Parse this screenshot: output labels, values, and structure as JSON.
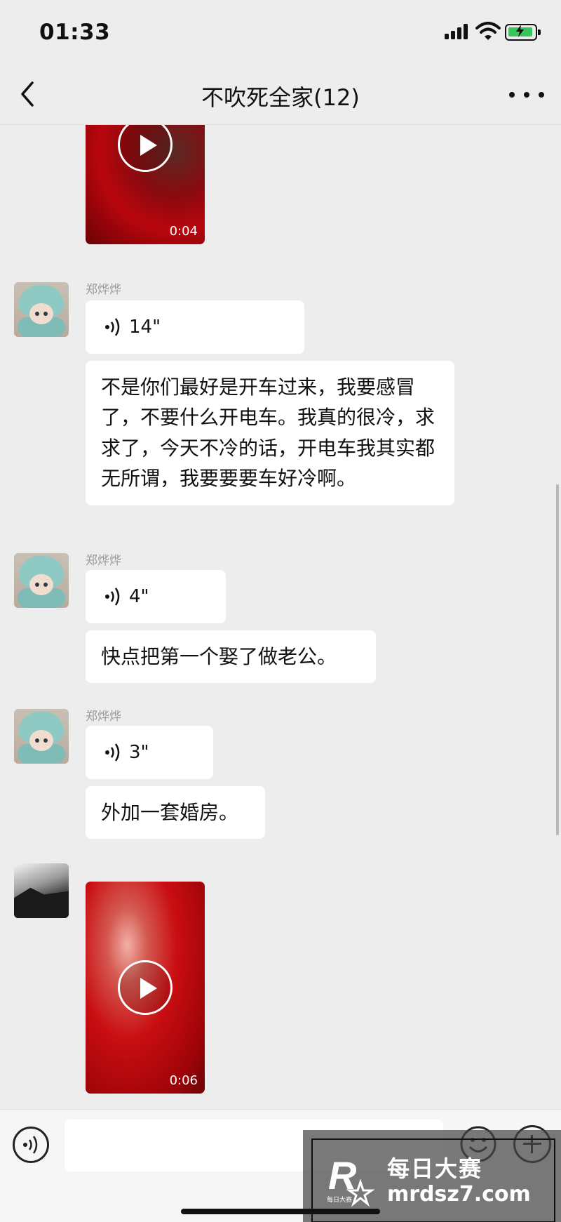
{
  "status_bar": {
    "time": "01:33"
  },
  "nav": {
    "title": "不吹死全家(12)"
  },
  "messages": {
    "video_top": {
      "duration": "0:04"
    },
    "group1": {
      "sender": "郑烨烨",
      "voice_duration": "14\"",
      "text": "不是你们最好是开车过来，我要感冒了，不要什么开电车。我真的很冷，求求了，今天不冷的话，开电车我其实都无所谓，我要要要车好冷啊。"
    },
    "group2": {
      "sender": "郑烨烨",
      "voice_duration": "4\"",
      "text": "快点把第一个娶了做老公。"
    },
    "group3": {
      "sender": "郑烨烨",
      "voice_duration": "3\"",
      "text": "外加一套婚房。"
    },
    "video_bottom": {
      "duration": "0:06"
    }
  },
  "input_bar": {
    "placeholder": ""
  },
  "watermark": {
    "line1": "每日大赛",
    "line2": "mrdsz7.com",
    "logo_letter": "R",
    "logo_small": "每日大赛"
  },
  "colors": {
    "background": "#ededed",
    "bubble": "#ffffff",
    "battery": "#35c759",
    "video": "#b8060d"
  },
  "icons": [
    "back-icon",
    "more-icon",
    "voice-wave-icon",
    "play-icon",
    "voice-input-icon",
    "emoji-icon",
    "plus-icon",
    "signal-icon",
    "wifi-icon",
    "battery-icon"
  ]
}
